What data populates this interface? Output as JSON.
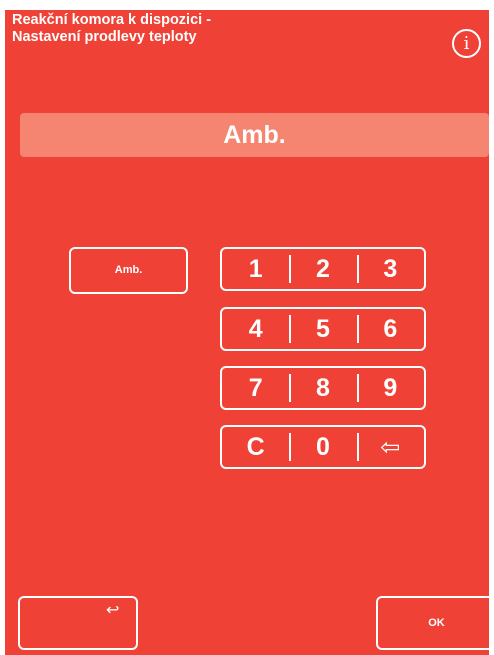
{
  "header": {
    "title_line1": "Reakční komora k dispozici -",
    "title_line2": "Nastavení prodlevy teploty",
    "info_glyph": "i"
  },
  "display": {
    "value": "Amb."
  },
  "preset": {
    "amb_label": "Amb."
  },
  "keypad": {
    "rows": [
      [
        "1",
        "2",
        "3"
      ],
      [
        "4",
        "5",
        "6"
      ],
      [
        "7",
        "8",
        "9"
      ],
      [
        "C",
        "0",
        "⇦"
      ]
    ]
  },
  "footer": {
    "back_icon": "↩",
    "ok_label": "OK"
  },
  "colors": {
    "background": "#ef4136",
    "display_bar": "#f58470",
    "foreground": "#ffffff"
  }
}
